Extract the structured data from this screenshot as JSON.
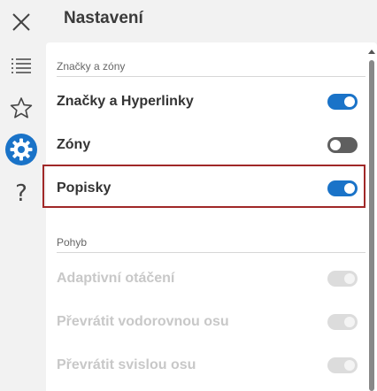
{
  "header": {
    "title": "Nastavení"
  },
  "rail": {
    "items": [
      {
        "icon": "close-icon"
      },
      {
        "icon": "list-icon"
      },
      {
        "icon": "star-icon"
      },
      {
        "icon": "gear-icon",
        "active": true
      },
      {
        "icon": "help-icon"
      }
    ],
    "help_glyph": "?"
  },
  "sections": [
    {
      "title": "Značky a zóny",
      "rows": [
        {
          "label": "Značky a Hyperlinky",
          "state": "on"
        },
        {
          "label": "Zóny",
          "state": "off"
        },
        {
          "label": "Popisky",
          "state": "on",
          "highlighted": true
        }
      ]
    },
    {
      "title": "Pohyb",
      "rows": [
        {
          "label": "Adaptivní otáčení",
          "state": "disabled"
        },
        {
          "label": "Převrátit vodorovnou osu",
          "state": "disabled"
        },
        {
          "label": "Převrátit svislou osu",
          "state": "disabled"
        }
      ]
    }
  ],
  "colors": {
    "accent": "#1a73c8",
    "highlight_border": "#a02828",
    "toggle_off": "#5f5f5f",
    "toggle_disabled": "#dcdcdc"
  }
}
